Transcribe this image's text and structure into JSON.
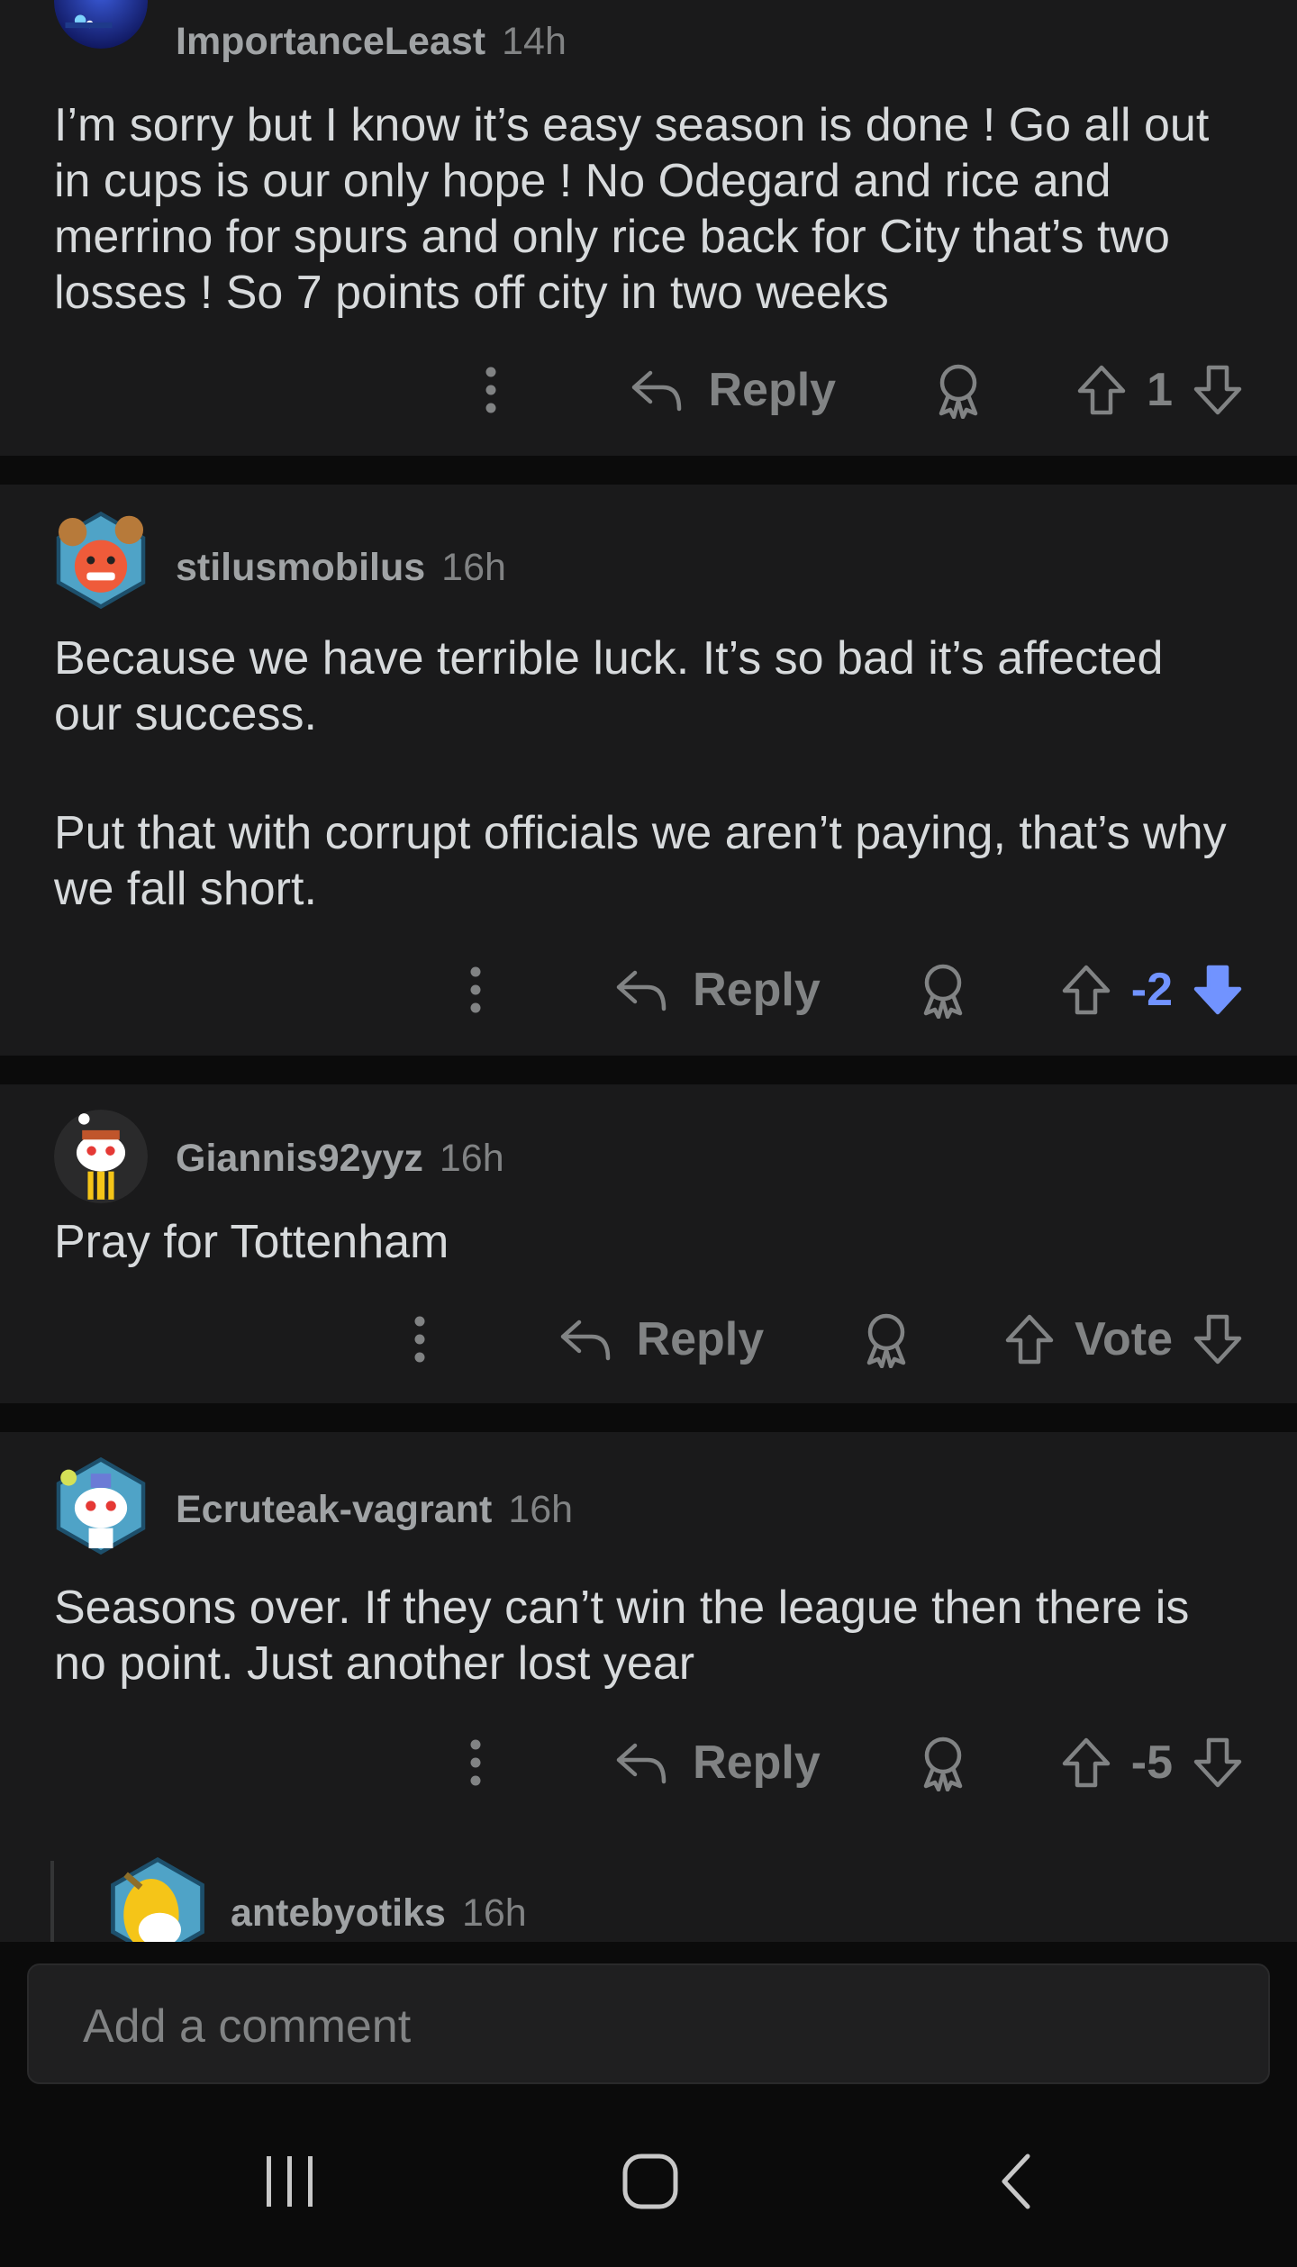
{
  "comments": [
    {
      "username": "ImportanceLeast",
      "time": "14h",
      "paragraphs": [
        "I’m sorry but I know it’s easy season is done ! Go all out in cups is our only hope ! No Odegard and rice and merrino for spurs and only rice back for City that’s two losses ! So 7 points off city in two weeks"
      ],
      "reply_label": "Reply",
      "vote": "1"
    },
    {
      "username": "stilusmobilus",
      "time": "16h",
      "paragraphs": [
        "Because we have terrible luck. It’s so bad it’s affected our success.",
        "Put that with corrupt officials we aren’t paying, that’s why we fall short."
      ],
      "reply_label": "Reply",
      "vote": "-2"
    },
    {
      "username": "Giannis92yyz",
      "time": "16h",
      "paragraphs": [
        "Pray for Tottenham"
      ],
      "reply_label": "Reply",
      "vote": "Vote"
    },
    {
      "username": "Ecruteak-vagrant",
      "time": "16h",
      "paragraphs": [
        "Seasons over. If they can’t win the league then there is no point. Just another lost year"
      ],
      "reply_label": "Reply",
      "vote": "-5"
    },
    {
      "username": "antebyotiks",
      "time": "16h"
    }
  ],
  "composer": {
    "placeholder": "Add a comment"
  },
  "icons": {
    "more": "more-vertical-icon",
    "reply": "reply-arrow-icon",
    "award": "award-icon",
    "upvote": "upvote-arrow-icon",
    "downvote": "downvote-arrow-icon",
    "nav_recents": "recent-apps-icon",
    "nav_home": "home-icon",
    "nav_back": "back-icon"
  },
  "colors": {
    "background": "#0b0b0b",
    "card": "#1a1a1b",
    "downvote_active": "#7193ff"
  }
}
